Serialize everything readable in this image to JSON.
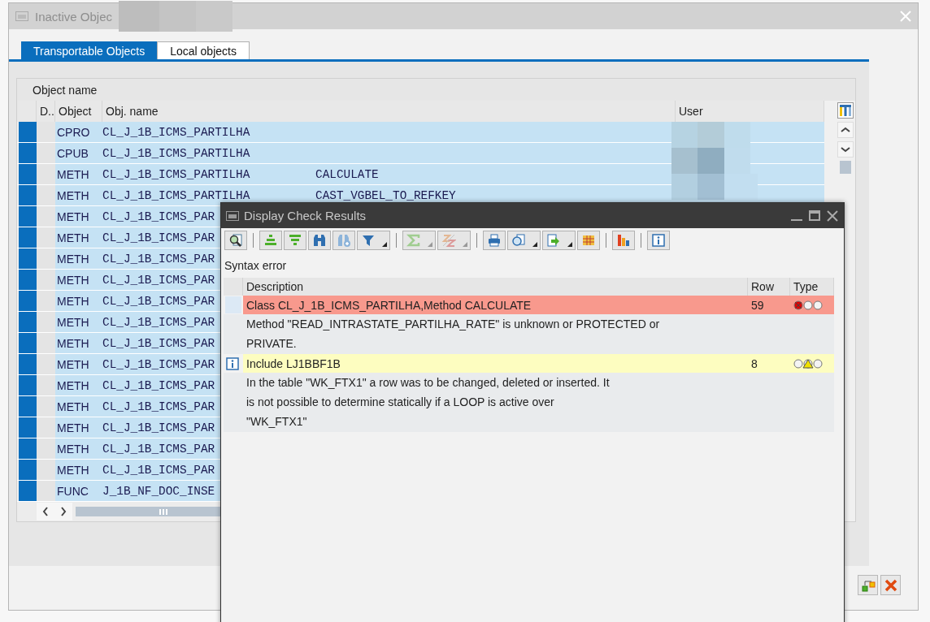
{
  "window": {
    "title": "Inactive Objec",
    "tabs": [
      {
        "label": "Transportable Objects",
        "selected": true
      },
      {
        "label": "Local objects",
        "selected": false
      }
    ],
    "table": {
      "title": "Object name",
      "columns": [
        "D..",
        "Object",
        "Obj. name",
        "User"
      ],
      "rows": [
        {
          "object": "CPRO",
          "obj_name": "CL_J_1B_ICMS_PARTILHA",
          "selected": true
        },
        {
          "object": "CPUB",
          "obj_name": "CL_J_1B_ICMS_PARTILHA",
          "selected": true
        },
        {
          "object": "METH",
          "obj_name": "CL_J_1B_ICMS_PARTILHA",
          "method": "CALCULATE",
          "selected": true
        },
        {
          "object": "METH",
          "obj_name": "CL_J_1B_ICMS_PARTILHA",
          "method": "CAST_VGBEL_TO_REFKEY",
          "selected": true
        },
        {
          "object": "METH",
          "obj_name": "CL_J_1B_ICMS_PAR",
          "selected": true
        },
        {
          "object": "METH",
          "obj_name": "CL_J_1B_ICMS_PAR",
          "selected": true
        },
        {
          "object": "METH",
          "obj_name": "CL_J_1B_ICMS_PAR",
          "selected": true
        },
        {
          "object": "METH",
          "obj_name": "CL_J_1B_ICMS_PAR",
          "selected": true
        },
        {
          "object": "METH",
          "obj_name": "CL_J_1B_ICMS_PAR",
          "selected": true
        },
        {
          "object": "METH",
          "obj_name": "CL_J_1B_ICMS_PAR",
          "selected": true
        },
        {
          "object": "METH",
          "obj_name": "CL_J_1B_ICMS_PAR",
          "selected": true
        },
        {
          "object": "METH",
          "obj_name": "CL_J_1B_ICMS_PAR",
          "selected": true
        },
        {
          "object": "METH",
          "obj_name": "CL_J_1B_ICMS_PAR",
          "selected": true
        },
        {
          "object": "METH",
          "obj_name": "CL_J_1B_ICMS_PAR",
          "selected": true
        },
        {
          "object": "METH",
          "obj_name": "CL_J_1B_ICMS_PAR",
          "selected": true
        },
        {
          "object": "METH",
          "obj_name": "CL_J_1B_ICMS_PAR",
          "selected": true
        },
        {
          "object": "METH",
          "obj_name": "CL_J_1B_ICMS_PAR",
          "selected": true
        },
        {
          "object": "FUNC",
          "obj_name": "J_1B_NF_DOC_INSE",
          "selected": true
        }
      ]
    }
  },
  "dialog": {
    "title": "Display Check Results",
    "toolbar": [
      [
        {
          "kind": "details",
          "menu": false,
          "disabled": false
        }
      ],
      [
        {
          "kind": "sort-asc",
          "menu": false,
          "disabled": false
        },
        {
          "kind": "sort-desc",
          "menu": false,
          "disabled": false
        },
        {
          "kind": "find",
          "menu": false,
          "disabled": false
        },
        {
          "kind": "find-next",
          "menu": false,
          "disabled": false
        },
        {
          "kind": "filter",
          "menu": true,
          "disabled": false
        }
      ],
      [
        {
          "kind": "sum",
          "menu": true,
          "disabled": true
        },
        {
          "kind": "subtotal",
          "menu": true,
          "disabled": true
        }
      ],
      [
        {
          "kind": "print",
          "menu": false,
          "disabled": false
        },
        {
          "kind": "view",
          "menu": true,
          "disabled": false
        },
        {
          "kind": "export",
          "menu": true,
          "disabled": false
        },
        {
          "kind": "layout",
          "menu": false,
          "disabled": false
        }
      ],
      [
        {
          "kind": "graphic",
          "menu": false,
          "disabled": false
        }
      ],
      [
        {
          "kind": "info",
          "menu": false,
          "disabled": false
        }
      ]
    ],
    "heading": "Syntax error",
    "columns": [
      "Description",
      "Row",
      "Type"
    ],
    "messages": [
      {
        "kind": "error",
        "title": "Class CL_J_1B_ICMS_PARTILHA,Method CALCULATE",
        "row": "59",
        "text": "Method \"READ_INTRASTATE_PARTILHA_RATE\" is unknown or PROTECTED or\nPRIVATE."
      },
      {
        "kind": "warning",
        "title": "Include LJ1BBF1B",
        "row": "8",
        "text": "In the table \"WK_FTX1\" a row was to be changed, deleted or inserted. It\nis not possible to determine statically if a LOOP is active over\n\"WK_FTX1\""
      }
    ]
  }
}
